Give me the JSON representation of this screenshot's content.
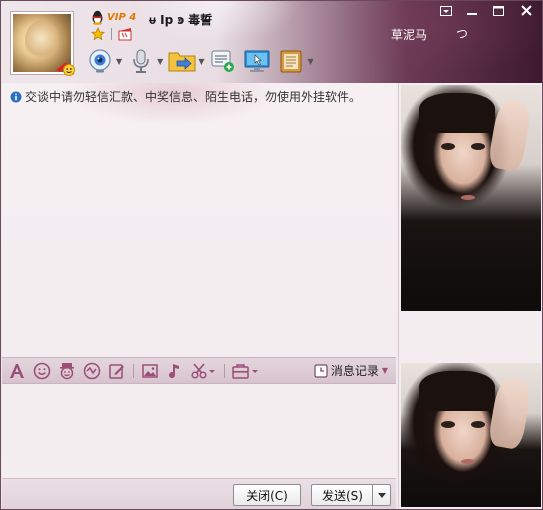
{
  "header": {
    "vip_label": "VIP 4",
    "nickname": "ᵾ Ip ͽ 毒誓",
    "signature": "草泥马",
    "signature_extra": "つ"
  },
  "window_controls": [
    "▾",
    "—",
    "☐",
    "✕"
  ],
  "toolbar": {
    "items": [
      {
        "name": "video-call",
        "icon": "webcam-icon"
      },
      {
        "name": "voice-call",
        "icon": "microphone-icon"
      },
      {
        "name": "send-file",
        "icon": "folder-arrow-icon"
      },
      {
        "name": "create-discussion",
        "icon": "chat-add-icon"
      },
      {
        "name": "remote-assistance",
        "icon": "monitor-cursor-icon"
      },
      {
        "name": "apps",
        "icon": "notebook-icon"
      }
    ]
  },
  "notice": "交谈中请勿轻信汇款、中奖信息、陌生电话，勿使用外挂软件。",
  "input_toolbar": {
    "history_label": "消息记录"
  },
  "buttons": {
    "close_label": "关闭(C)",
    "send_label": "发送(S)"
  },
  "colors": {
    "header_dark": "#3d1a2e",
    "toolbar_icon": "#a0557c",
    "vip_orange": "#e07a00"
  }
}
